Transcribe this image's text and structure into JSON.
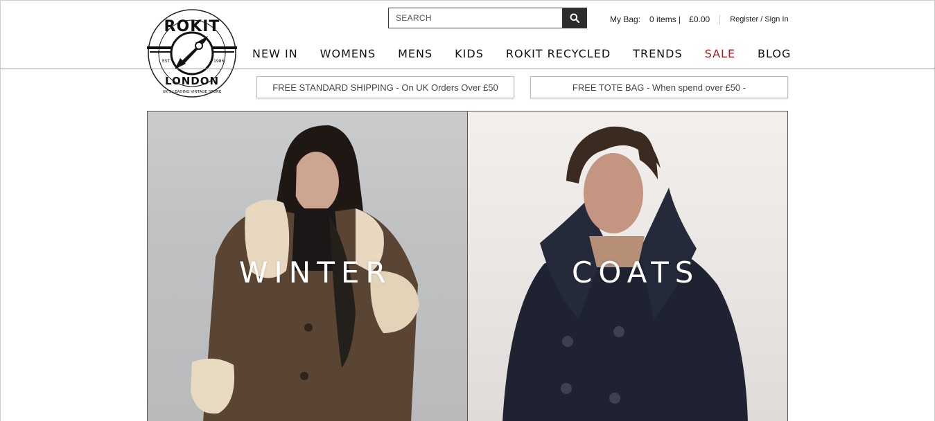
{
  "brand": {
    "name": "ROKIT",
    "city": "LONDON",
    "established": "EST.",
    "year": "1986",
    "tagline": "UK'S LEADING VINTAGE STORE"
  },
  "search": {
    "placeholder": "SEARCH",
    "icon": "magnifier-icon"
  },
  "bag": {
    "label": "My Bag:",
    "items": "0 items |",
    "total": "£0.00"
  },
  "account": {
    "link": "Register / Sign In"
  },
  "nav": [
    "NEW IN",
    "WOMENS",
    "MENS",
    "KIDS",
    "ROKIT RECYCLED",
    "TRENDS",
    "SALE",
    "BLOG"
  ],
  "promos": [
    "FREE STANDARD SHIPPING - On UK Orders Over £50",
    "FREE TOTE BAG - When spend over £50 -"
  ],
  "hero": {
    "left_word": "WINTER",
    "right_word": "COATS"
  },
  "colors": {
    "sale": "#a51d1d",
    "search_button": "#2d2d2d"
  }
}
